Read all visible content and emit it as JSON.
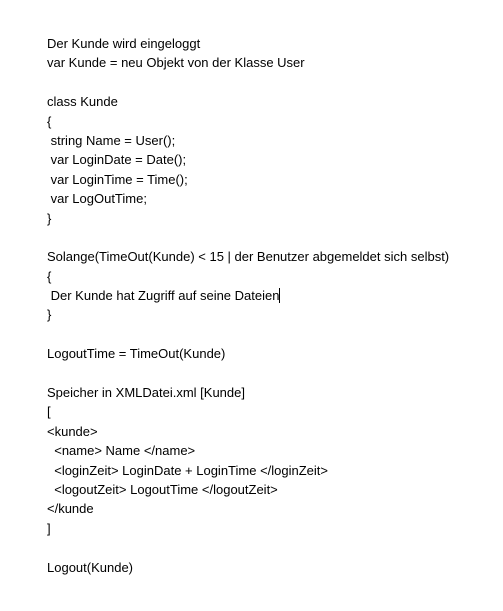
{
  "document": {
    "lines": [
      "Der Kunde wird eingeloggt",
      "var Kunde = neu Objekt von der Klasse User",
      "",
      "class Kunde",
      "{",
      " string Name = User();",
      " var LoginDate = Date();",
      " var LoginTime = Time();",
      " var LogOutTime;",
      "}",
      "",
      "Solange(TimeOut(Kunde) < 15 | der Benutzer abgemeldet sich selbst)",
      "{",
      " Der Kunde hat Zugriff auf seine Dateien",
      "}",
      "",
      "LogoutTime = TimeOut(Kunde)",
      "",
      "Speicher in XMLDatei.xml [Kunde]",
      "[",
      "<kunde>",
      "  <name> Name </name>",
      "  <loginZeit> LoginDate + LoginTime </loginZeit>",
      "  <logoutZeit> LogoutTime </logoutZeit>",
      "</kunde",
      "]",
      "",
      "Logout(Kunde)"
    ]
  }
}
